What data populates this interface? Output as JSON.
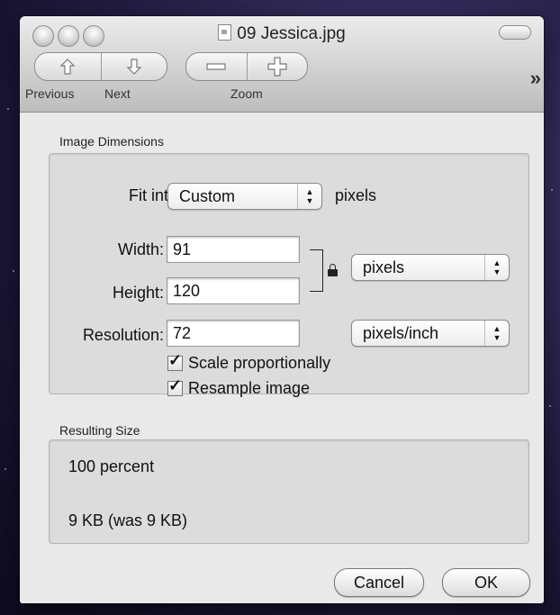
{
  "window": {
    "title": "09 Jessica.jpg"
  },
  "toolbar": {
    "previous_label": "Previous",
    "next_label": "Next",
    "zoom_label": "Zoom",
    "overflow": "»"
  },
  "image_dimensions": {
    "group_label": "Image Dimensions",
    "fit_into_label": "Fit into:",
    "fit_into_value": "Custom",
    "fit_into_unit": "pixels",
    "width_label": "Width:",
    "width_value": "91",
    "height_label": "Height:",
    "height_value": "120",
    "size_unit": "pixels",
    "resolution_label": "Resolution:",
    "resolution_value": "72",
    "resolution_unit": "pixels/inch",
    "scale_label": "Scale proportionally",
    "scale_checked": true,
    "resample_label": "Resample image",
    "resample_checked": true
  },
  "resulting_size": {
    "group_label": "Resulting Size",
    "percent": "100 percent",
    "filesize": "9 KB (was 9 KB)"
  },
  "buttons": {
    "cancel": "Cancel",
    "ok": "OK"
  },
  "icons": [
    "close-icon",
    "minimize-icon",
    "zoom-icon",
    "document-icon",
    "toolbar-toggle-icon",
    "up-arrow-icon",
    "down-arrow-icon",
    "minus-icon",
    "plus-icon",
    "lock-icon",
    "popup-arrows-icon",
    "checkmark-icon"
  ]
}
